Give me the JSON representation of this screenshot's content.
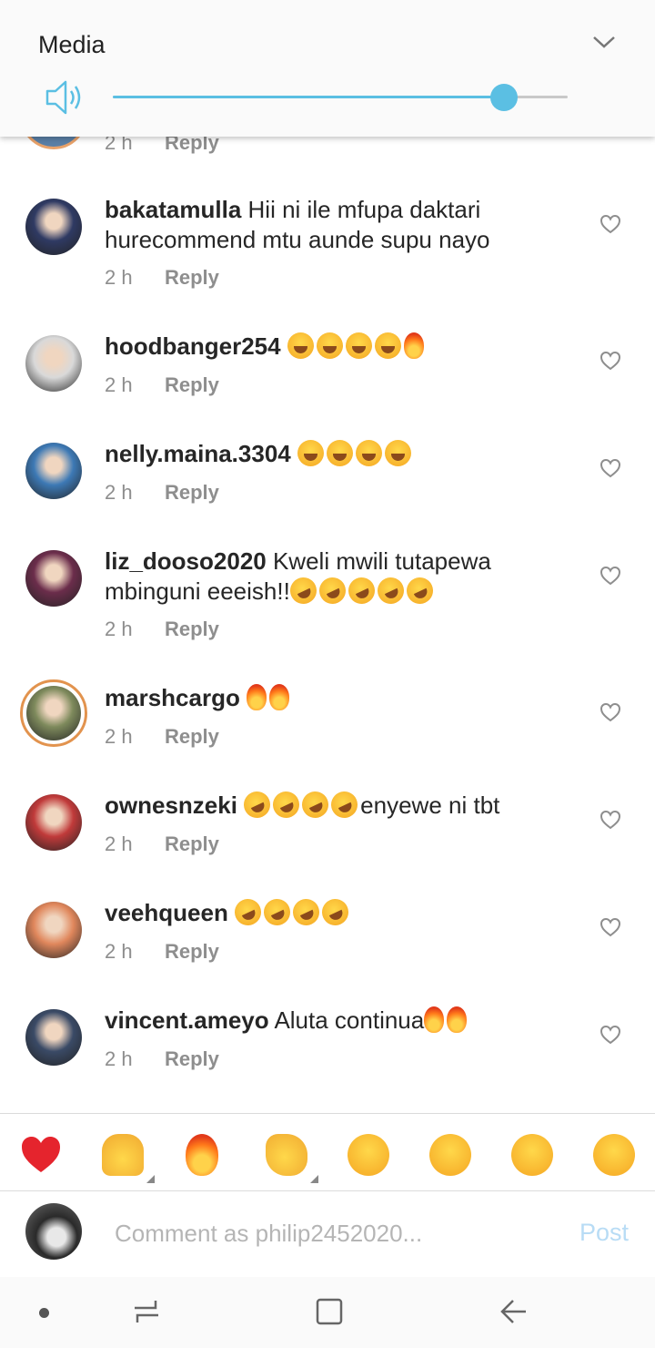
{
  "media_panel": {
    "title": "Media",
    "volume_level": 0.86
  },
  "partial_comment": {
    "time": "2 h",
    "reply_label": "Reply"
  },
  "comments": [
    {
      "username": "bakatamulla",
      "text": "Hii ni ile mfupa daktari hurecommend mtu aunde supu nayo",
      "emojis": [],
      "time": "2 h",
      "reply_label": "Reply",
      "avatar_color": "#2f3a63"
    },
    {
      "username": "hoodbanger254",
      "text": "",
      "emojis": [
        "laugh",
        "laugh",
        "laugh",
        "laugh",
        "fire"
      ],
      "time": "2 h",
      "reply_label": "Reply",
      "avatar_color": "#d9d9d9"
    },
    {
      "username": "nelly.maina.3304",
      "text": "",
      "emojis": [
        "laugh",
        "laugh",
        "laugh",
        "laugh"
      ],
      "time": "2 h",
      "reply_label": "Reply",
      "avatar_color": "#3d79b5"
    },
    {
      "username": "liz_dooso2020",
      "text": "Kweli mwili tutapewa mbinguni eeeish!!",
      "emojis": [
        "rofl",
        "rofl",
        "rofl",
        "rofl",
        "rofl"
      ],
      "time": "2 h",
      "reply_label": "Reply",
      "avatar_color": "#6b2d4b"
    },
    {
      "username": "marshcargo",
      "text": "",
      "emojis": [
        "fire",
        "fire"
      ],
      "time": "2 h",
      "reply_label": "Reply",
      "avatar_color": "#7e8a5c"
    },
    {
      "username": "ownesnzeki",
      "text": "enyewe ni tbt",
      "emojis": [
        "rofl",
        "rofl",
        "rofl",
        "rofl"
      ],
      "time": "2 h",
      "reply_label": "Reply",
      "avatar_color": "#c03a3a"
    },
    {
      "username": "veehqueen",
      "text": "",
      "emojis": [
        "rofl",
        "rofl",
        "rofl",
        "rofl"
      ],
      "time": "2 h",
      "reply_label": "Reply",
      "avatar_color": "#e0875c"
    },
    {
      "username": "vincent.ameyo",
      "text": "Aluta continua",
      "emojis": [
        "fire",
        "fire"
      ],
      "time": "2 h",
      "reply_label": "Reply",
      "avatar_color": "#3a4a66"
    }
  ],
  "quick_emojis": [
    "red-heart",
    "raising-hands",
    "fire",
    "clapping-hands",
    "crying-face",
    "heart-eyes-face",
    "surprised-face",
    "tears-of-joy-face"
  ],
  "composer": {
    "placeholder": "Comment as philip2452020...",
    "post_label": "Post"
  },
  "navbar": [
    "dot",
    "recent-apps",
    "home",
    "back"
  ]
}
